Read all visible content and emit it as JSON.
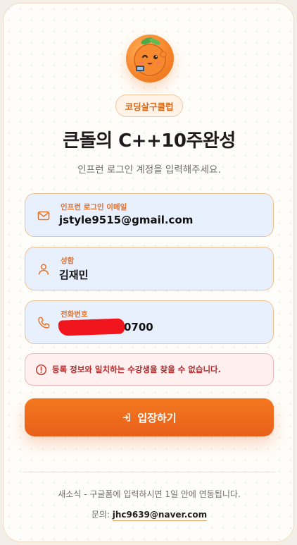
{
  "badge": "코딩살구클럽",
  "title": "큰돌의 C++10주완성",
  "subtitle": "인프런 로그인 계정을 입력해주세요.",
  "fields": {
    "email": {
      "label": "인프런 로그인 이메일",
      "value": "jstyle9515@gmail.com",
      "icon": "mail-icon"
    },
    "name": {
      "label": "성함",
      "value": "김재민",
      "icon": "user-icon"
    },
    "phone": {
      "label": "전화번호",
      "value_visible": "0700",
      "icon": "phone-icon"
    }
  },
  "alert": {
    "message": "등록 정보와 일치하는 수강생을 찾을 수 없습니다.",
    "icon": "alert-circle-icon"
  },
  "enter_button": {
    "label": "입장하기",
    "icon": "login-icon"
  },
  "footer": {
    "note": "새소식 - 구글폼에 입력하시면 1일 안에 연동됩니다.",
    "contact_label": "문의:",
    "contact_email": "jhc9639@naver.com"
  },
  "colors": {
    "accent": "#e8601a",
    "field_bg": "#e9f0fd",
    "field_border": "#f0c08f",
    "alert_text": "#b32a2a",
    "alert_bg": "#fff0ef"
  }
}
